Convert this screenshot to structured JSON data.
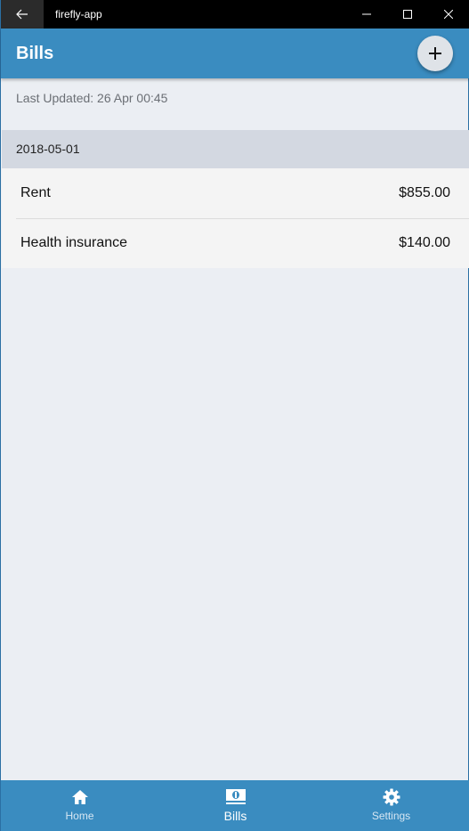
{
  "window": {
    "title": "firefly-app"
  },
  "header": {
    "title": "Bills"
  },
  "status": {
    "last_updated": "Last Updated: 26 Apr 00:45"
  },
  "bills": {
    "section_date": "2018-05-01",
    "items": [
      {
        "name": "Rent",
        "amount": "$855.00"
      },
      {
        "name": "Health insurance",
        "amount": "$140.00"
      }
    ]
  },
  "nav": {
    "items": [
      {
        "label": "Home",
        "icon": "home-icon"
      },
      {
        "label": "Bills",
        "icon": "money-icon",
        "active": true
      },
      {
        "label": "Settings",
        "icon": "gear-icon"
      }
    ]
  },
  "colors": {
    "primary": "#3a8cc0",
    "background": "#ebeef3",
    "section_header": "#d3d8e1",
    "row_background": "#f4f4f4"
  }
}
